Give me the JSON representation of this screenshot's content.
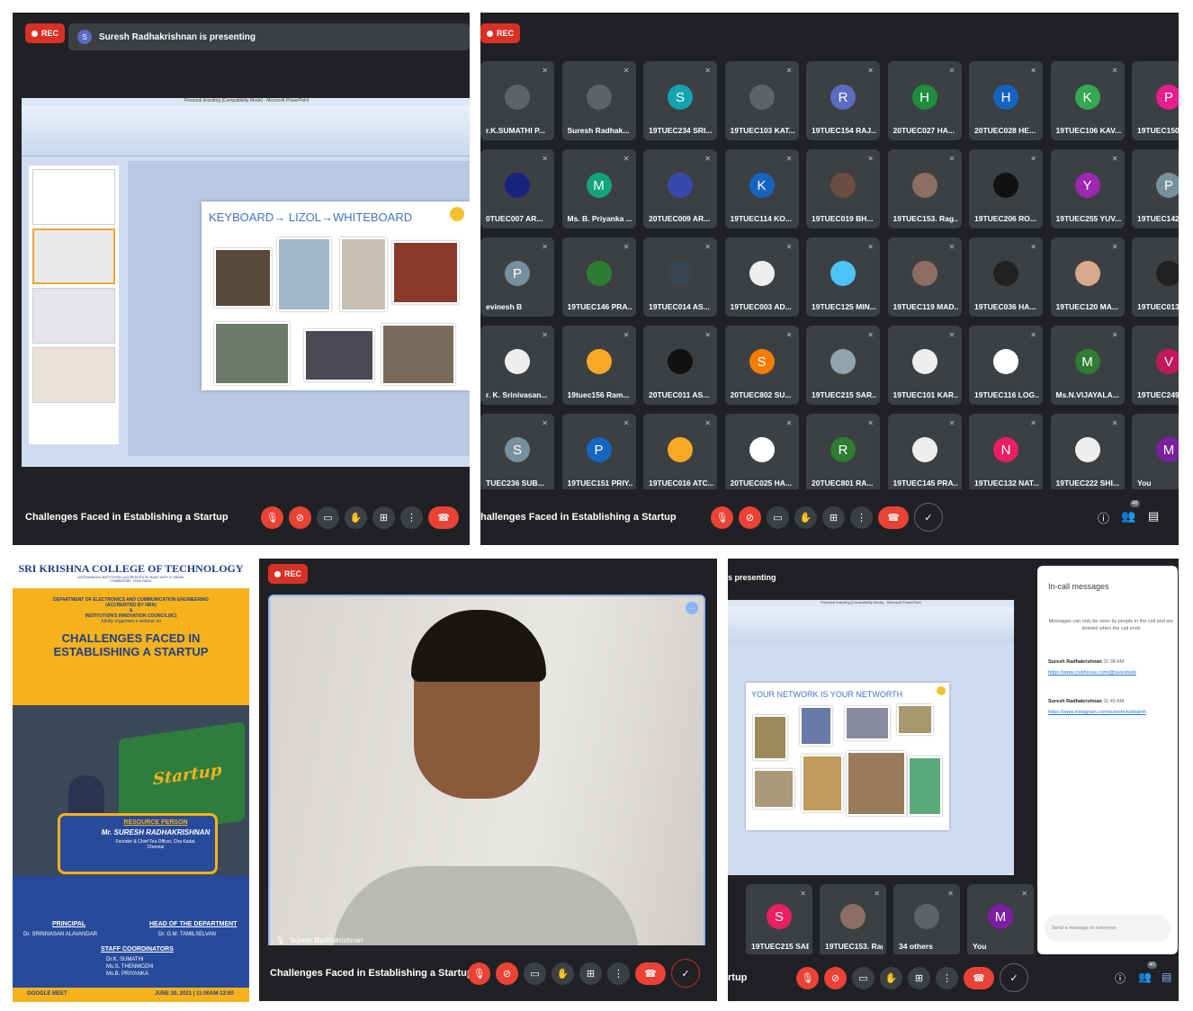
{
  "meeting_title": "Challenges Faced in Establishing a Startup",
  "meeting_title_cut": "hallenges Faced in Establishing a Startup",
  "meeting_title_cut2": "rtup",
  "rec_label": "REC",
  "panel1": {
    "presenting": "Suresh Radhakrishnan is presenting",
    "presenter_avatar": "S",
    "ppt_title": "Personal branding [Compatibility Mode] - Microsoft PowerPoint",
    "slide_title": "KEYBOARD→ LIZOL→WHITEBOARD"
  },
  "panel2": {
    "participants_count": "46",
    "tiles": [
      {
        "name": "r.K.SUMATHI P...",
        "avatar": "",
        "color": "#5f6368"
      },
      {
        "name": "Suresh Radhak...",
        "avatar": "",
        "color": "#5f6368"
      },
      {
        "name": "19TUEC234 SRI...",
        "avatar": "S",
        "color": "#12a4af"
      },
      {
        "name": "19TUEC103 KAT...",
        "avatar": "",
        "color": "#5f6368"
      },
      {
        "name": "19TUEC154 RAJ...",
        "avatar": "R",
        "color": "#5c6bc0"
      },
      {
        "name": "20TUEC027 HA...",
        "avatar": "H",
        "color": "#1e8e3e"
      },
      {
        "name": "20TUEC028 HE...",
        "avatar": "H",
        "color": "#1565c0"
      },
      {
        "name": "19TUEC106 KAV...",
        "avatar": "K",
        "color": "#34a853"
      },
      {
        "name": "19TUEC150 PR...",
        "avatar": "P",
        "color": "#e91e8c"
      },
      {
        "name": "0TUEC007 AR...",
        "avatar": "",
        "color": "#1a237e"
      },
      {
        "name": "Ms. B. Priyanka ...",
        "avatar": "M",
        "color": "#12a47a"
      },
      {
        "name": "20TUEC009 AR...",
        "avatar": "",
        "color": "#3949ab"
      },
      {
        "name": "19TUEC114 KO...",
        "avatar": "K",
        "color": "#1565c0"
      },
      {
        "name": "19TUEC019 BH...",
        "avatar": "",
        "color": "#6d4c41"
      },
      {
        "name": "19TUEC153. Rag...",
        "avatar": "",
        "color": "#8d6e63"
      },
      {
        "name": "19TUEC206 RO...",
        "avatar": "",
        "color": "#111111"
      },
      {
        "name": "19TUEC255 YUV...",
        "avatar": "Y",
        "color": "#9c27b0"
      },
      {
        "name": "19TUEC142 PO...",
        "avatar": "P",
        "color": "#78909c"
      },
      {
        "name": "evinesh B",
        "avatar": "P",
        "color": "#78909c"
      },
      {
        "name": "19TUEC146 PRA...",
        "avatar": "",
        "color": "#2e7d32"
      },
      {
        "name": "19TUEC014 AS...",
        "avatar": "",
        "color": "#37474f"
      },
      {
        "name": "19TUEC003 AD...",
        "avatar": "",
        "color": "#eeeeee"
      },
      {
        "name": "19TUEC125 MIN...",
        "avatar": "",
        "color": "#4fc3f7"
      },
      {
        "name": "19TUEC119 MAD...",
        "avatar": "",
        "color": "#8d6e63"
      },
      {
        "name": "19TUEC036 HA...",
        "avatar": "",
        "color": "#212121"
      },
      {
        "name": "19TUEC120 MA...",
        "avatar": "",
        "color": "#d7a98c"
      },
      {
        "name": "19TUEC013 AS...",
        "avatar": "",
        "color": "#212121"
      },
      {
        "name": "r. K. Srinivasan...",
        "avatar": "",
        "color": "#eeeeee"
      },
      {
        "name": "19tuec156 Ram...",
        "avatar": "",
        "color": "#f9a825"
      },
      {
        "name": "20TUEC011 AS...",
        "avatar": "",
        "color": "#111111"
      },
      {
        "name": "20TUEC802 SU...",
        "avatar": "S",
        "color": "#f57c00"
      },
      {
        "name": "19TUEC215 SAR...",
        "avatar": "",
        "color": "#90a4ae"
      },
      {
        "name": "19TUEC101 KAR...",
        "avatar": "",
        "color": "#eeeeee"
      },
      {
        "name": "19TUEC116 LOG...",
        "avatar": "",
        "color": "#ffffff"
      },
      {
        "name": "Ms.N.VIJAYALA...",
        "avatar": "M",
        "color": "#2e7d32"
      },
      {
        "name": "19TUEC249 VI...",
        "avatar": "V",
        "color": "#c2185b"
      },
      {
        "name": "TUEC236 SUB...",
        "avatar": "S",
        "color": "#78909c"
      },
      {
        "name": "19TUEC151 PRIY...",
        "avatar": "P",
        "color": "#1565c0"
      },
      {
        "name": "19TUEC016 ATC...",
        "avatar": "",
        "color": "#f9a825"
      },
      {
        "name": "20TUEC025 HA...",
        "avatar": "",
        "color": "#ffffff"
      },
      {
        "name": "20TUEC801 RA...",
        "avatar": "R",
        "color": "#2e7d32"
      },
      {
        "name": "19TUEC145 PRA...",
        "avatar": "",
        "color": "#eeeeee"
      },
      {
        "name": "19TUEC132 NAT...",
        "avatar": "N",
        "color": "#e91e63"
      },
      {
        "name": "19TUEC222 SHI...",
        "avatar": "",
        "color": "#eeeeee"
      },
      {
        "name": "You",
        "avatar": "M",
        "color": "#7b1fa2"
      }
    ]
  },
  "poster": {
    "college": "SRI KRISHNA COLLEGE OF TECHNOLOGY",
    "college_sub": "AUTONOMOUS INSTITUTION | ACCREDITED BY NAAC WITH 'A' GRADE",
    "city": "COIMBATORE, TAMIL NADU",
    "dept": "DEPARTMENT OF ELECTRONICS AND COMMUNICATION ENGINEERING",
    "nba": "(ACCREDITED BY NBA)",
    "amp": "&",
    "iic": "INSTITUTION'S INNOVATION COUNCIL(IIC)",
    "jointly": "Jointly organises a webinar on",
    "headline": "CHALLENGES FACED IN ESTABLISHING A STARTUP",
    "startup_word": "Startup",
    "resource_label": "RESOURCE PERSON",
    "resource_name": "Mr. SURESH RADHAKRISHNAN",
    "resource_role": "Founder & Chief Tea Officer, Cha Kadai,",
    "resource_city": "Chennai",
    "principal_label": "PRINCIPAL",
    "principal_name": "Dr. SRINIVASAN ALAVANDAR",
    "hod_label": "HEAD OF THE DEPARTMENT",
    "hod_name": "Dr. G.M. TAMILSELVAN",
    "staff_label": "STAFF COORDINATORS",
    "staff": [
      "Dr.K. SUMATHI",
      "Ms.S. THENMOZHI",
      "Ms.B. PRIYANKA"
    ],
    "platform": "GOOGLE MEET",
    "date": "JUNE 30, 2021 | 11:00AM-12:00"
  },
  "panel4": {
    "speaker_name": "Suresh Radhakrishnan"
  },
  "panel5": {
    "presenting": "s presenting",
    "ppt_title": "Personal branding [Compatibility Mode] - Microsoft PowerPoint",
    "slide_title": "YOUR NETWORK IS YOUR NETWORTH",
    "chat_title": "In-call messages",
    "chat_note": "Messages can only be seen by people in the call and are deleted when the call ends",
    "messages": [
      {
        "sender": "Suresh Radhakrishnan",
        "time": "11:38 AM",
        "link": "https://www.clubhouse.com/@sureshark"
      },
      {
        "sender": "Suresh Radhakrishnan",
        "time": "11:40 AM",
        "link": "https://www.instagram.com/sureshchakkanth"
      }
    ],
    "chat_placeholder": "Send a message to everyone",
    "participants_count": "40",
    "tiles": [
      {
        "name": "19TUEC215 SABR...",
        "avatar": "S",
        "color": "#e91e63"
      },
      {
        "name": "19TUEC153. Ragh...",
        "avatar": "",
        "color": "#8d6e63"
      },
      {
        "name": "34 others",
        "avatar": "",
        "color": "#5f6368"
      },
      {
        "name": "You",
        "avatar": "M",
        "color": "#7b1fa2"
      }
    ]
  },
  "colors": {
    "meet_bg": "#202124",
    "tile_bg": "#3c4043",
    "rec": "#d93025",
    "hangup": "#ea4335",
    "poster_yellow": "#f6b21b",
    "poster_blue": "#274a9a"
  }
}
